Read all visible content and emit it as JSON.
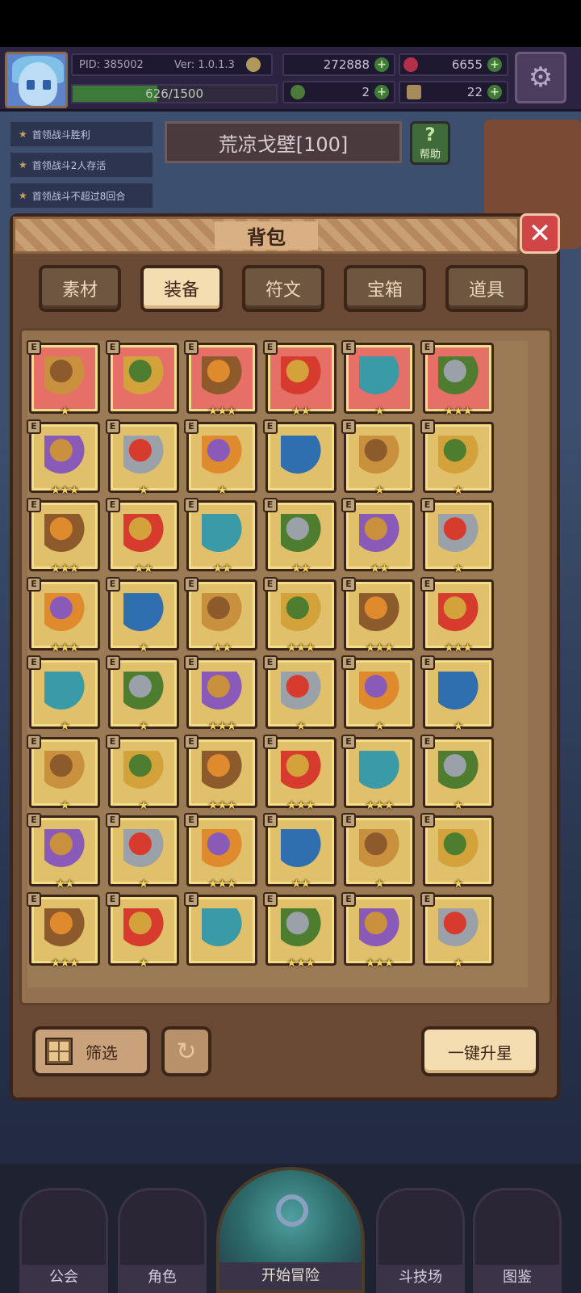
{
  "hud": {
    "pid": "PID: 385002",
    "version": "Ver: 1.0.1.3",
    "gold": "272888",
    "gems": "6655",
    "energy": "626/1500",
    "energy_fraction": 0.417,
    "clover": "2",
    "boots": "22"
  },
  "quests": [
    "首领战斗胜利",
    "首领战斗2人存活",
    "首领战斗不超过8回合"
  ],
  "location": "荒凉戈壁[100]",
  "help_label": "帮助",
  "panel": {
    "title": "背包",
    "tabs": [
      "素材",
      "装备",
      "符文",
      "宝箱",
      "道具"
    ],
    "active_tab": 1,
    "badge_letter": "E",
    "items": [
      {
        "icon": "straw-hat-icon",
        "stars": 1,
        "bg": "red"
      },
      {
        "icon": "heart-amulet-icon",
        "stars": 0,
        "bg": "red"
      },
      {
        "icon": "gold-ring-icon",
        "stars": 3,
        "bg": "red"
      },
      {
        "icon": "fire-ring-icon",
        "stars": 2,
        "bg": "red"
      },
      {
        "icon": "horned-helm-icon",
        "stars": 1,
        "bg": "red"
      },
      {
        "icon": "jewel-ring-icon",
        "stars": 3,
        "bg": "red"
      },
      {
        "icon": "mace-icon",
        "stars": 3,
        "bg": "gold"
      },
      {
        "icon": "staff-icon",
        "stars": 1,
        "bg": "gold"
      },
      {
        "icon": "bow-icon",
        "stars": 1,
        "bg": "gold"
      },
      {
        "icon": "wooden-club-icon",
        "stars": 0,
        "bg": "gold"
      },
      {
        "icon": "trident-icon",
        "stars": 1,
        "bg": "gold"
      },
      {
        "icon": "bone-club-icon",
        "stars": 1,
        "bg": "gold"
      },
      {
        "icon": "gold-bracelet-icon",
        "stars": 3,
        "bg": "gold"
      },
      {
        "icon": "bronze-helm-icon",
        "stars": 2,
        "bg": "gold"
      },
      {
        "icon": "winged-helm-icon",
        "stars": 2,
        "bg": "gold"
      },
      {
        "icon": "red-pendant-icon",
        "stars": 2,
        "bg": "gold"
      },
      {
        "icon": "green-hood-icon",
        "stars": 2,
        "bg": "gold"
      },
      {
        "icon": "teal-helm-icon",
        "stars": 1,
        "bg": "gold"
      },
      {
        "icon": "ice-armor-icon",
        "stars": 3,
        "bg": "gold"
      },
      {
        "icon": "crimson-armor-icon",
        "stars": 1,
        "bg": "gold"
      },
      {
        "icon": "green-armor-icon",
        "stars": 2,
        "bg": "gold"
      },
      {
        "icon": "bone-scepter-icon",
        "stars": 3,
        "bg": "gold"
      },
      {
        "icon": "blue-glove-icon",
        "stars": 3,
        "bg": "gold"
      },
      {
        "icon": "red-glove-icon",
        "stars": 3,
        "bg": "gold"
      },
      {
        "icon": "green-scroll-icon",
        "stars": 1,
        "bg": "gold"
      },
      {
        "icon": "spiked-ring-icon",
        "stars": 1,
        "bg": "gold"
      },
      {
        "icon": "gem-ring-icon",
        "stars": 3,
        "bg": "gold"
      },
      {
        "icon": "thin-ring-icon",
        "stars": 1,
        "bg": "gold"
      },
      {
        "icon": "red-cuff-icon",
        "stars": 1,
        "bg": "gold"
      },
      {
        "icon": "purple-gauntlet-icon",
        "stars": 1,
        "bg": "gold"
      },
      {
        "icon": "teal-belt-icon",
        "stars": 1,
        "bg": "gold"
      },
      {
        "icon": "crest-belt-icon",
        "stars": 1,
        "bg": "gold"
      },
      {
        "icon": "gold-boots-icon",
        "stars": 3,
        "bg": "gold"
      },
      {
        "icon": "dark-boots-icon",
        "stars": 3,
        "bg": "gold"
      },
      {
        "icon": "red-boots-icon",
        "stars": 3,
        "bg": "gold"
      },
      {
        "icon": "purple-boots-icon",
        "stars": 1,
        "bg": "gold"
      },
      {
        "icon": "teal-potion-icon",
        "stars": 2,
        "bg": "gold"
      },
      {
        "icon": "stone-pile-icon",
        "stars": 1,
        "bg": "gold"
      },
      {
        "icon": "gold-shield-icon",
        "stars": 3,
        "bg": "gold"
      },
      {
        "icon": "pink-orb-icon",
        "stars": 2,
        "bg": "gold"
      },
      {
        "icon": "leaf-crest-icon",
        "stars": 1,
        "bg": "gold"
      },
      {
        "icon": "iron-shield-icon",
        "stars": 1,
        "bg": "gold"
      },
      {
        "icon": "ruby-necklace-icon",
        "stars": 3,
        "bg": "gold"
      },
      {
        "icon": "emerald-necklace-icon",
        "stars": 1,
        "bg": "gold"
      },
      {
        "icon": "heart-necklace-icon",
        "stars": 0,
        "bg": "gold"
      },
      {
        "icon": "topaz-ring-icon",
        "stars": 3,
        "bg": "gold"
      },
      {
        "icon": "crystal-drop-icon",
        "stars": 3,
        "bg": "gold"
      },
      {
        "icon": "gold-crown-icon",
        "stars": 1,
        "bg": "gold"
      }
    ],
    "filter_label": "筛选",
    "upgrade_label": "一键升星"
  },
  "nav": {
    "guild": "公会",
    "character": "角色",
    "adventure": "开始冒险",
    "arena": "斗技场",
    "codex": "图鉴"
  },
  "colors": {
    "panel_brown": "#6b4a35",
    "cell_gold": "#e0c06a",
    "cell_red": "#e66f68",
    "tab_active": "#f4ddb0",
    "star_yellow": "#f4d35e"
  }
}
